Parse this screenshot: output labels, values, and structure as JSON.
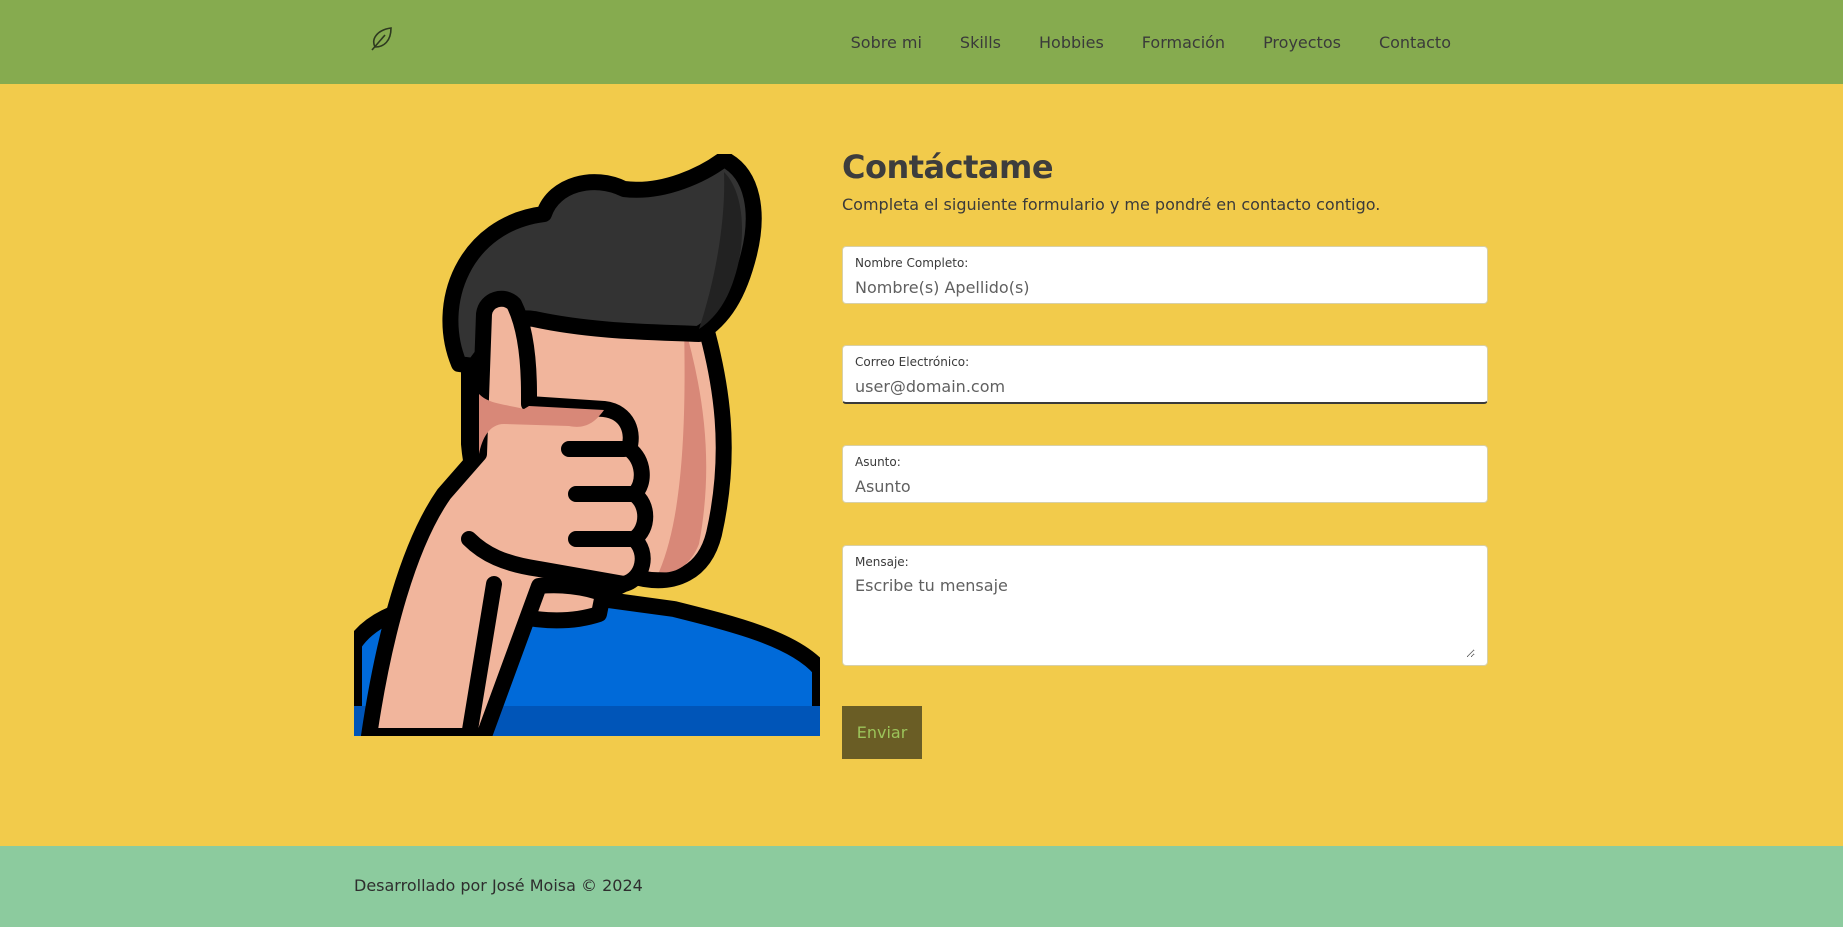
{
  "header": {
    "logo_icon": "leaf-icon",
    "nav": [
      {
        "label": "Sobre mi"
      },
      {
        "label": "Skills"
      },
      {
        "label": "Hobbies"
      },
      {
        "label": "Formación"
      },
      {
        "label": "Proyectos"
      },
      {
        "label": "Contacto"
      }
    ]
  },
  "contact": {
    "illustration_icon": "thumbs-up-person-icon",
    "title": "Contáctame",
    "subtitle": "Completa el siguiente formulario y me pondré en contacto contigo.",
    "fields": {
      "name": {
        "label": "Nombre Completo:",
        "placeholder": "Nombre(s) Apellido(s)",
        "value": ""
      },
      "email": {
        "label": "Correo Electrónico:",
        "placeholder": "user@domain.com",
        "value": ""
      },
      "subject": {
        "label": "Asunto:",
        "placeholder": "Asunto",
        "value": ""
      },
      "message": {
        "label": "Mensaje:",
        "placeholder": "Escribe tu mensaje",
        "value": ""
      }
    },
    "submit_label": "Enviar"
  },
  "footer": {
    "text": "Desarrollado por José Moisa © 2024"
  },
  "colors": {
    "navbar": "#86ab4f",
    "background": "#f2cb4b",
    "footer": "#8ccb9e",
    "button": "#6a5d25",
    "button_text": "#9cc45a"
  }
}
